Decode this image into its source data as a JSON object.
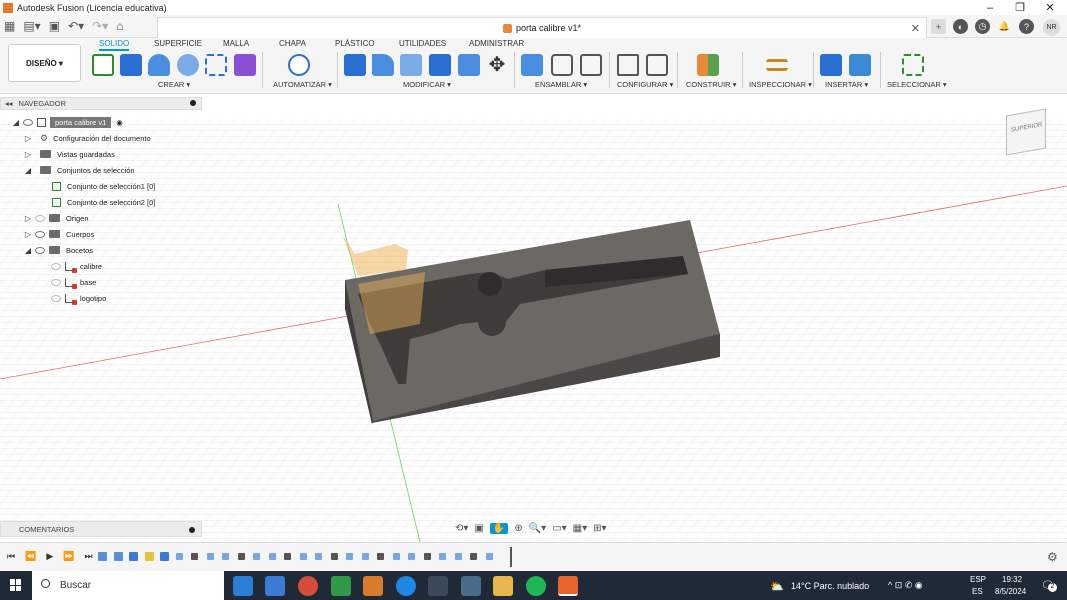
{
  "window": {
    "title": "Autodesk Fusion (Licencia educativa)",
    "doc_title": "porta calibre v1*",
    "user_initials": "NR"
  },
  "toolbar": {
    "workspace": "DISEÑO",
    "tabs": [
      "SOLIDO",
      "SUPERFICIE",
      "MALLA",
      "CHAPA",
      "PLÁSTICO",
      "UTILIDADES",
      "ADMINISTRAR"
    ],
    "groups": [
      "CREAR ▾",
      "AUTOMATIZAR ▾",
      "MODIFICAR ▾",
      "ENSAMBLAR ▾",
      "CONFIGURAR ▾",
      "CONSTRUIR ▾",
      "INSPECCIONAR ▾",
      "INSERTAR ▾",
      "SELECCIONAR ▾"
    ]
  },
  "browser": {
    "header": "NAVEGADOR",
    "root": "porta calibre v1",
    "items": [
      "Configuración del documento",
      "Vistas guardadas",
      "Conjuntos de selección",
      "Conjunto de selección1 [0]",
      "Conjunto de selección2 [0]",
      "Origen",
      "Cuerpos",
      "Bocetos",
      "calibre",
      "base",
      "logotipo"
    ]
  },
  "viewcube": {
    "label": "SUPERIOR"
  },
  "comments": {
    "label": "COMENTARIOS"
  },
  "taskbar": {
    "search_placeholder": "Buscar",
    "weather": "14°C  Parc. nublado",
    "lang_top": "ESP",
    "lang_bottom": "ES",
    "time": "19:32",
    "date": "8/5/2024",
    "notifications": "2"
  },
  "colors": {
    "accent": "#0696d7",
    "model_body": "#5e5b57",
    "fusion_orange": "#e8893a"
  }
}
